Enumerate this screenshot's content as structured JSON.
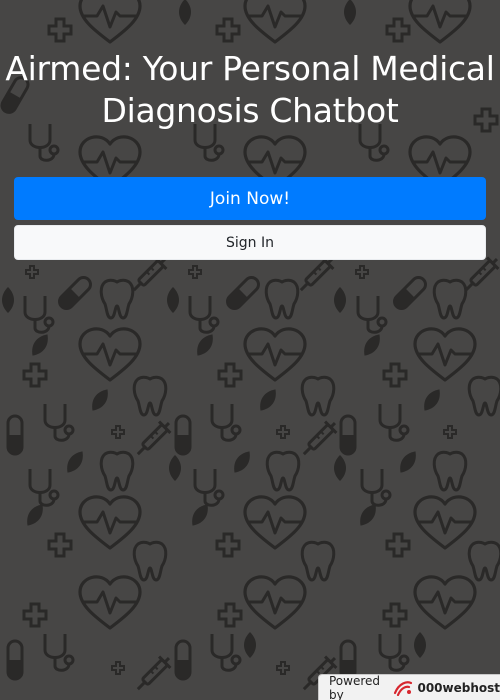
{
  "page": {
    "background_color": "#474645",
    "pattern_color": "#2a2928",
    "pattern_icons": [
      "heart-pulse-icon",
      "cross-icon",
      "pill-icon",
      "tooth-icon",
      "syringe-icon",
      "leaf-icon",
      "stethoscope-icon"
    ]
  },
  "header": {
    "title": "Airmed: Your Personal Medical Diagnosis Chatbot"
  },
  "actions": {
    "join_label": "Join Now!",
    "join_color": "#007bff",
    "signin_label": "Sign In"
  },
  "footer_badge": {
    "powered_by": "Powered by",
    "brand": "000webhost",
    "logo_icon": "000webhost-logo-icon",
    "logo_color": "#d7262e"
  }
}
